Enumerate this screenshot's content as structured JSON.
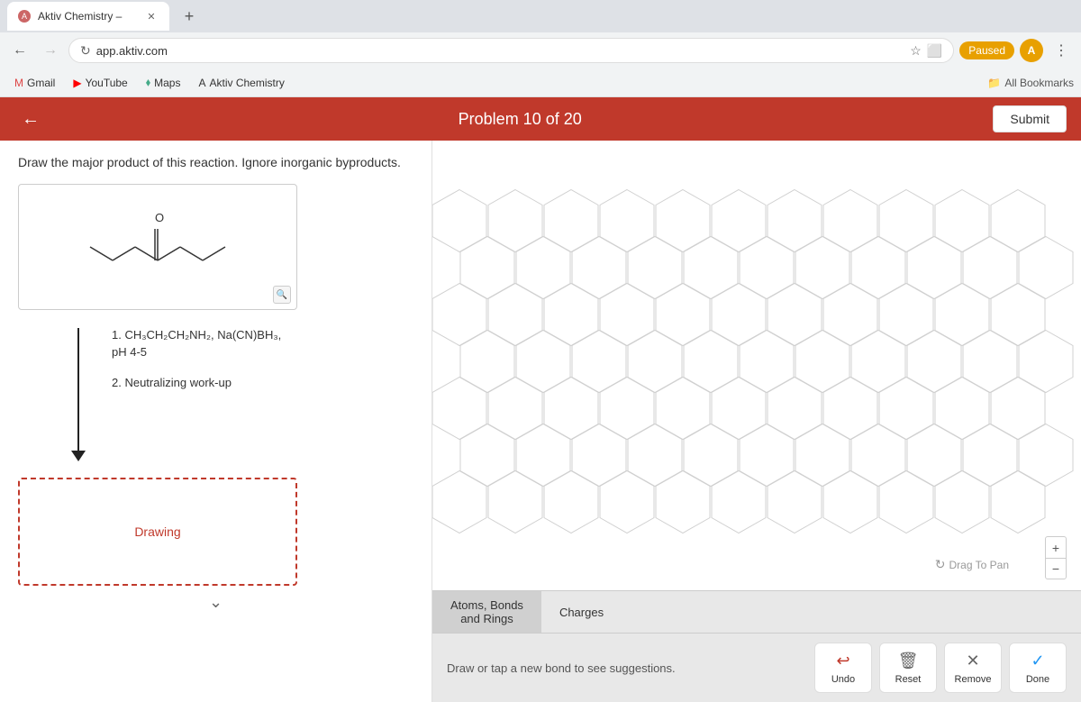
{
  "browser": {
    "tab_title": "Aktiv Chemistry –",
    "url": "app.aktiv.com",
    "paused_label": "Paused",
    "profile_initial": "A",
    "new_tab_label": "+",
    "back_label": "←",
    "forward_label": "→",
    "reload_label": "↻",
    "more_label": "⋮",
    "all_bookmarks_label": "All Bookmarks"
  },
  "bookmarks": [
    {
      "id": "gmail",
      "label": "Gmail",
      "icon": "M"
    },
    {
      "id": "youtube",
      "label": "YouTube",
      "icon": "▶"
    },
    {
      "id": "maps",
      "label": "Maps",
      "icon": "⬧"
    },
    {
      "id": "aktiv",
      "label": "Aktiv Chemistry",
      "icon": "A"
    }
  ],
  "app": {
    "back_label": "←",
    "problem_title": "Problem 10 of 20",
    "submit_label": "Submit"
  },
  "question": {
    "text": "Draw the major product of this reaction. Ignore inorganic byproducts.",
    "conditions": {
      "step1": "1. CH₃CH₂CH₂NH₂, Na(CN)BH₃,",
      "step1b": "pH 4-5",
      "step2": "2. Neutralizing work-up"
    },
    "drawing_placeholder": "Drawing"
  },
  "toolbar": {
    "tab1_label": "Atoms, Bonds\nand Rings",
    "tab2_label": "Charges",
    "hint": "Draw or tap a new bond to see suggestions.",
    "undo_label": "Undo",
    "reset_label": "Reset",
    "remove_label": "Remove",
    "done_label": "Done",
    "pan_hint": "Drag To Pan",
    "zoom_in_label": "+",
    "zoom_out_label": "−"
  }
}
